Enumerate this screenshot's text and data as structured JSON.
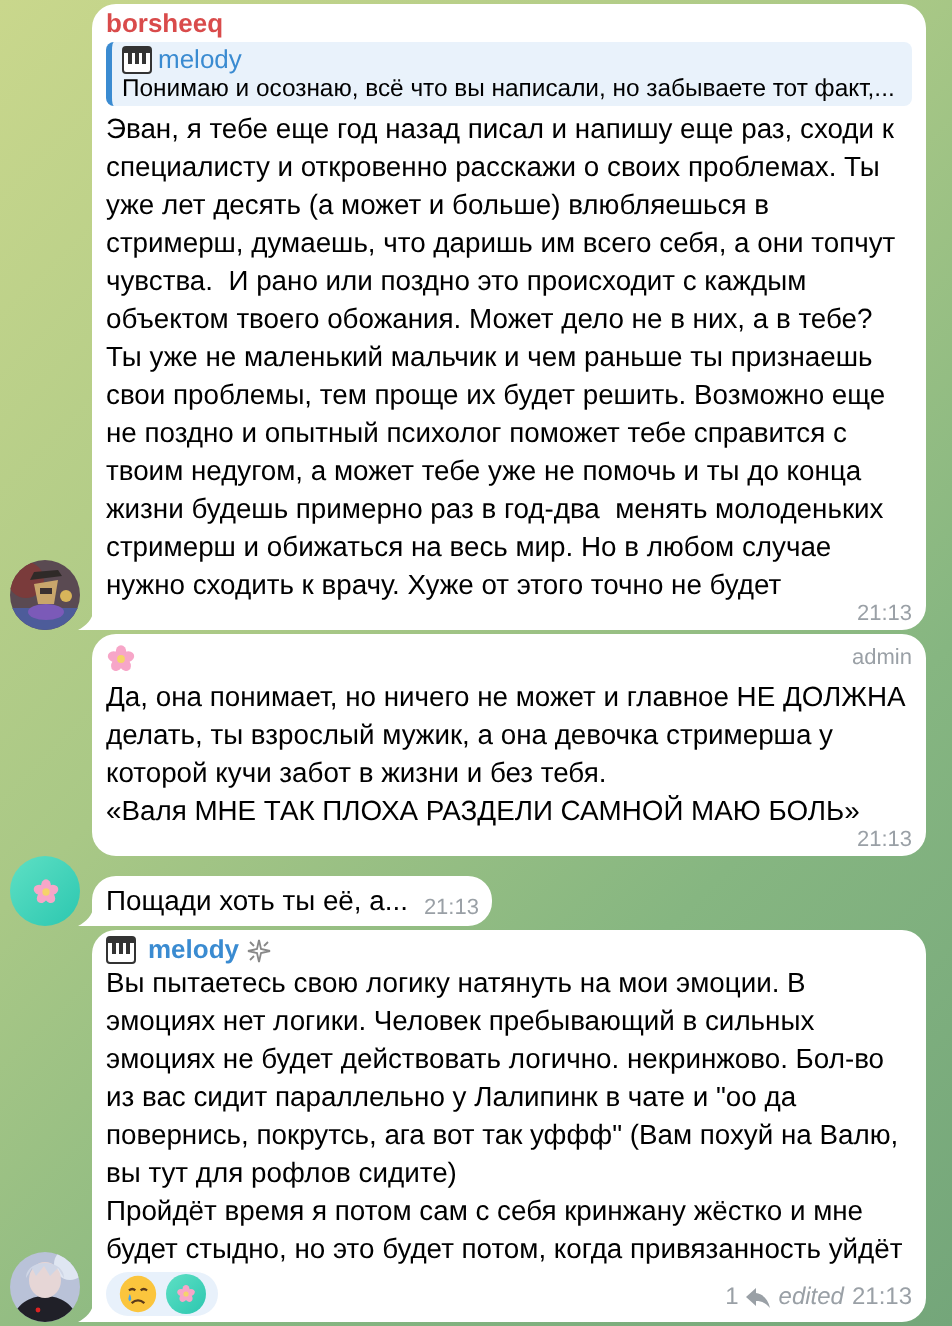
{
  "messages": [
    {
      "sender": {
        "kind": "name",
        "name": "borsheeq",
        "color": "#d94b4b"
      },
      "reply": {
        "sender": "melody",
        "color": "#3a8bd1",
        "text": "Понимаю и осознаю, всё что вы написали, но забываете тот факт,..."
      },
      "text": "Эван, я тебе еще год назад писал и напишу еще раз, сходи к специалисту и откровенно расскажи о своих проблемах. Ты уже лет десять (а может и больше) влюбляешься в стримерш, думаешь, что даришь им всего себя, а они топчут чувства.  И рано или поздно это происходит с каждым объектом твоего обожания. Может дело не в них, а в тебе? Ты уже не маленький мальчик и чем раньше ты признаешь свои проблемы, тем проще их будет решить. Возможно еще не поздно и опытный психолог поможет тебе справится с твоим недугом, а может тебе уже не помочь и ты до конца жизни будешь примерно раз в год-два  менять молоденьких стримерш и обижаться на весь мир. Но в любом случае нужно сходить к врачу. Хуже от этого точно не будет",
      "time": "21:13"
    },
    {
      "sender": {
        "kind": "flower"
      },
      "role": "admin",
      "text": "Да, она понимает, но ничего не может и главное НЕ ДОЛЖНА делать, ты взрослый мужик, а она девочка стримерша у которой кучи забот в жизни и без тебя.\n«Валя МНЕ ТАК ПЛОХА РАЗДЕЛИ САМНОЙ МАЮ БОЛЬ»",
      "time": "21:13"
    },
    {
      "avatar": {
        "kind": "flower"
      },
      "text": "Пощади хоть ты её, а...",
      "time": "21:13",
      "compact": true
    },
    {
      "sender": {
        "kind": "name",
        "name": "melody",
        "color": "#3a8bd1",
        "piano": true,
        "sparkle": true
      },
      "text": "Вы пытаетесь свою логику натянуть на мои эмоции. В эмоциях нет логики. Человек пребывающий в сильных эмоциях не будет действовать логично. некринжово. Бол-во из вас сидит параллельно у Лалипинк в чате и \"оо да повернись, покрутсь, ага вот так уффф\" (Вам похуй на Валю, вы тут для рофлов сидите)\nПройдёт время я потом сам с себя кринжану жёстко и мне будет стыдно, но это будет потом, когда привязанность уйдёт",
      "reactions": [
        {
          "kind": "crying"
        },
        {
          "kind": "flower-avatar"
        }
      ],
      "replies": "1",
      "edited": "edited",
      "time": "21:13"
    }
  ]
}
